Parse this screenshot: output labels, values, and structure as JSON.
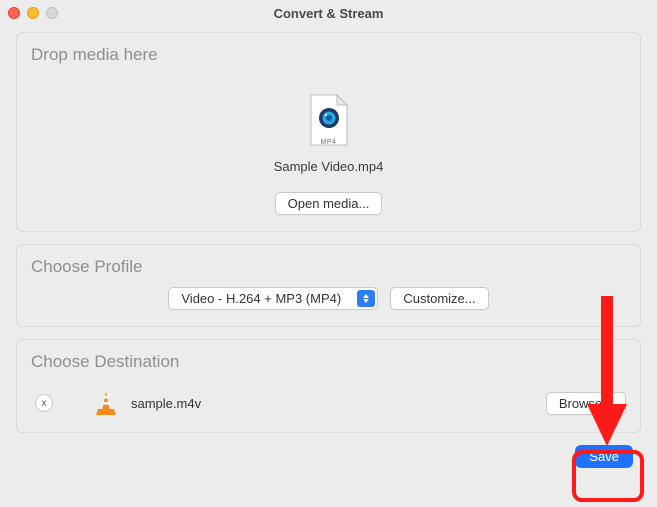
{
  "window": {
    "title": "Convert & Stream"
  },
  "drop": {
    "heading": "Drop media here",
    "file_type_badge": "MP4",
    "file_name": "Sample Video.mp4",
    "open_button": "Open media..."
  },
  "profile": {
    "heading": "Choose Profile",
    "selected": "Video - H.264 + MP3 (MP4)",
    "customize_button": "Customize..."
  },
  "destination": {
    "heading": "Choose Destination",
    "output_name": "sample.m4v",
    "browse_button": "Browse...",
    "remove_symbol": "x"
  },
  "footer": {
    "save_button": "Save"
  }
}
